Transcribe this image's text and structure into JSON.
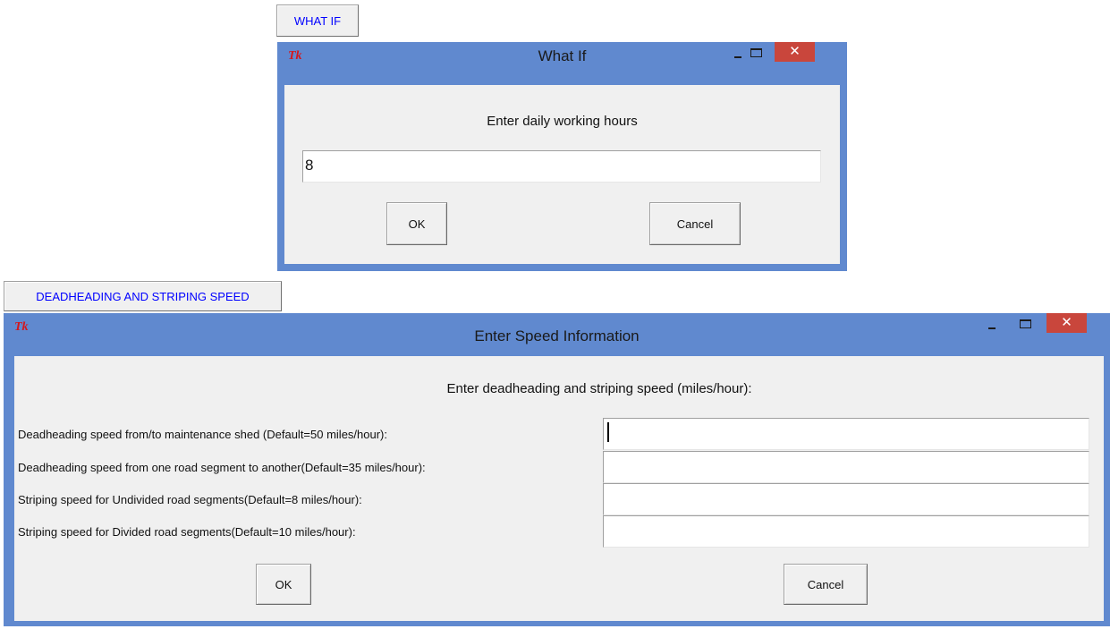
{
  "buttons": {
    "what_if": "WHAT IF",
    "deadheading": "DEADHEADING AND STRIPING SPEED"
  },
  "whatif_dialog": {
    "icon": "Tk",
    "title": "What If",
    "close_glyph": "✕",
    "prompt": "Enter daily working hours",
    "value": "8",
    "ok": "OK",
    "cancel": "Cancel"
  },
  "speed_dialog": {
    "icon": "Tk",
    "title": "Enter Speed Information",
    "close_glyph": "✕",
    "prompt": "Enter deadheading and striping speed (miles/hour):",
    "fields": [
      {
        "label": "Deadheading speed from/to maintenance shed (Default=50 miles/hour):",
        "value": ""
      },
      {
        "label": "Deadheading speed from one road segment to another(Default=35 miles/hour):",
        "value": ""
      },
      {
        "label": "Striping speed for Undivided road segments(Default=8 miles/hour):",
        "value": ""
      },
      {
        "label": "Striping speed for Divided road segments(Default=10 miles/hour):",
        "value": ""
      }
    ],
    "ok": "OK",
    "cancel": "Cancel"
  },
  "colors": {
    "title_bar": "#6089cf",
    "close_button": "#c9463c",
    "dialog_bg": "#f0f0f0",
    "button_text_blue": "#0000ff",
    "tk_logo": "#d4161c"
  }
}
